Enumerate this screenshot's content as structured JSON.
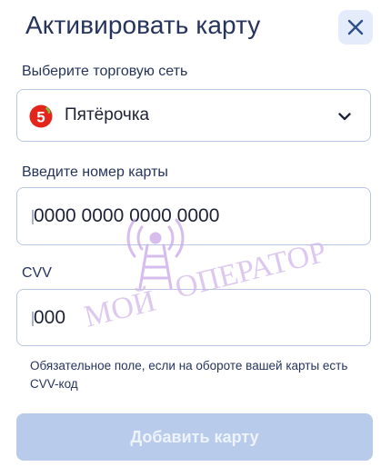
{
  "dialog": {
    "title": "Активировать карту",
    "close_icon": "close-icon"
  },
  "store": {
    "label": "Выберите торговую сеть",
    "selected": "Пятёрочка",
    "logo_icon": "pyaterochka-logo-icon",
    "chevron_icon": "chevron-down-icon"
  },
  "card_number": {
    "label": "Введите номер карты",
    "placeholder": "0000 0000 0000 0000"
  },
  "cvv": {
    "label": "CVV",
    "placeholder": "000",
    "hint": "Обязательное поле, если на обороте вашей карты есть CVV-код"
  },
  "submit": {
    "label": "Добавить карту",
    "disabled": true
  },
  "watermark": {
    "text_left": "МОЙ",
    "text_right": "ОПЕРАТОР",
    "icon": "radio-tower-icon"
  },
  "colors": {
    "title": "#26345c",
    "border": "#b9c6e6",
    "close_bg": "#e4ebfa",
    "button_disabled": "#b8cbea",
    "logo_red": "#e3251c",
    "logo_green": "#7cbf3a"
  }
}
